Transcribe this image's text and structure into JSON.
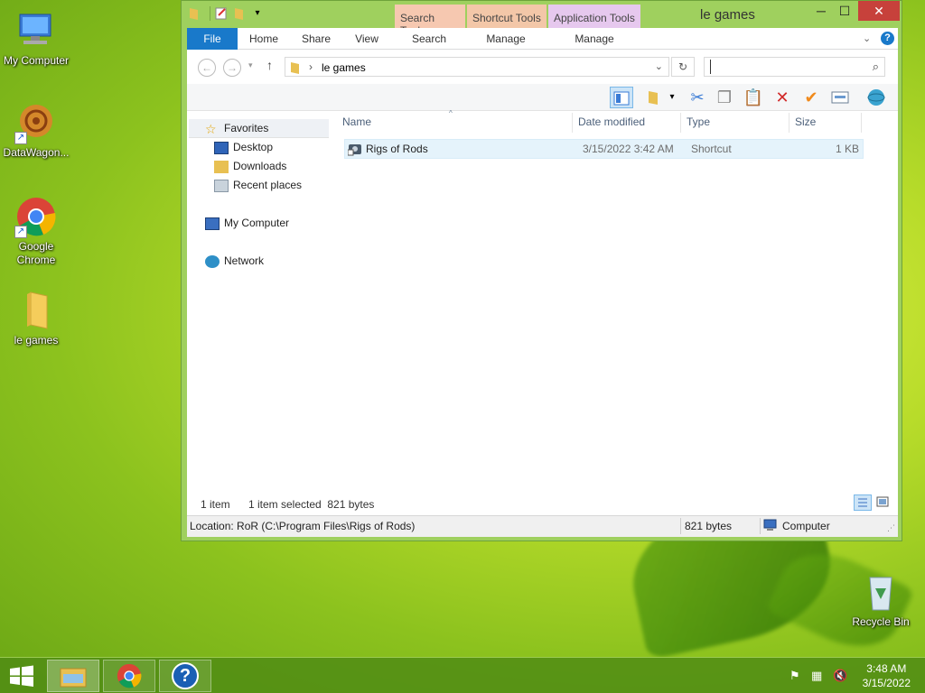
{
  "desktop": {
    "icons": [
      {
        "label": "My Computer"
      },
      {
        "label": "DataWagon..."
      },
      {
        "label": "Google Chrome"
      },
      {
        "label": "le games"
      },
      {
        "label": "Recycle Bin"
      }
    ]
  },
  "window": {
    "title": "le games",
    "context_tabs": [
      "Search Tools",
      "Shortcut Tools",
      "Application Tools"
    ],
    "ribbon_tabs": [
      "File",
      "Home",
      "Share",
      "View",
      "Search",
      "Manage",
      "Manage"
    ],
    "controls": {
      "minimize": "─",
      "maximize": "☐",
      "close": "✕"
    },
    "address": {
      "path": "le games",
      "separator": "›"
    },
    "search": {
      "placeholder": ""
    },
    "nav": {
      "favorites": "Favorites",
      "desktop": "Desktop",
      "downloads": "Downloads",
      "recent": "Recent places",
      "computer": "My Computer",
      "network": "Network"
    },
    "columns": {
      "name": "Name",
      "date": "Date modified",
      "type": "Type",
      "size": "Size"
    },
    "files": [
      {
        "name": "Rigs of Rods",
        "date": "3/15/2022 3:42 AM",
        "type": "Shortcut",
        "size": "1 KB"
      }
    ],
    "status": {
      "items": "1 item",
      "selected": "1 item selected  821 bytes",
      "location": "Location: RoR (C:\\Program Files\\Rigs of Rods)",
      "bytes": "821 bytes",
      "zone": "Computer"
    }
  },
  "taskbar": {
    "time": "3:48 AM",
    "date": "3/15/2022"
  },
  "colors": {
    "accent": "#1979ca",
    "close": "#c7413b",
    "search_tools": "#f6c8b0",
    "shortcut_tools": "#f3c7a8",
    "application_tools": "#e6c8ee"
  }
}
